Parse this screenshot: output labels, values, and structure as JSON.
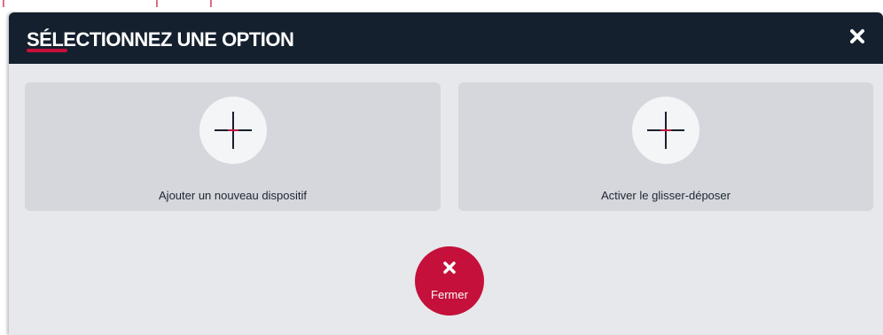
{
  "dialog": {
    "title": "SÉLECTIONNEZ UNE OPTION",
    "close_icon": "close-icon"
  },
  "options": [
    {
      "label": "Ajouter un nouveau dispositif",
      "icon": "plus-icon"
    },
    {
      "label": "Activer le glisser-déposer",
      "icon": "plus-icon"
    }
  ],
  "footer": {
    "close_label": "Fermer",
    "close_icon": "close-icon"
  },
  "colors": {
    "header_bg": "#15202e",
    "accent": "#c4103a",
    "card_bg": "#d5d7dd",
    "body_bg": "#e7e8ec"
  }
}
